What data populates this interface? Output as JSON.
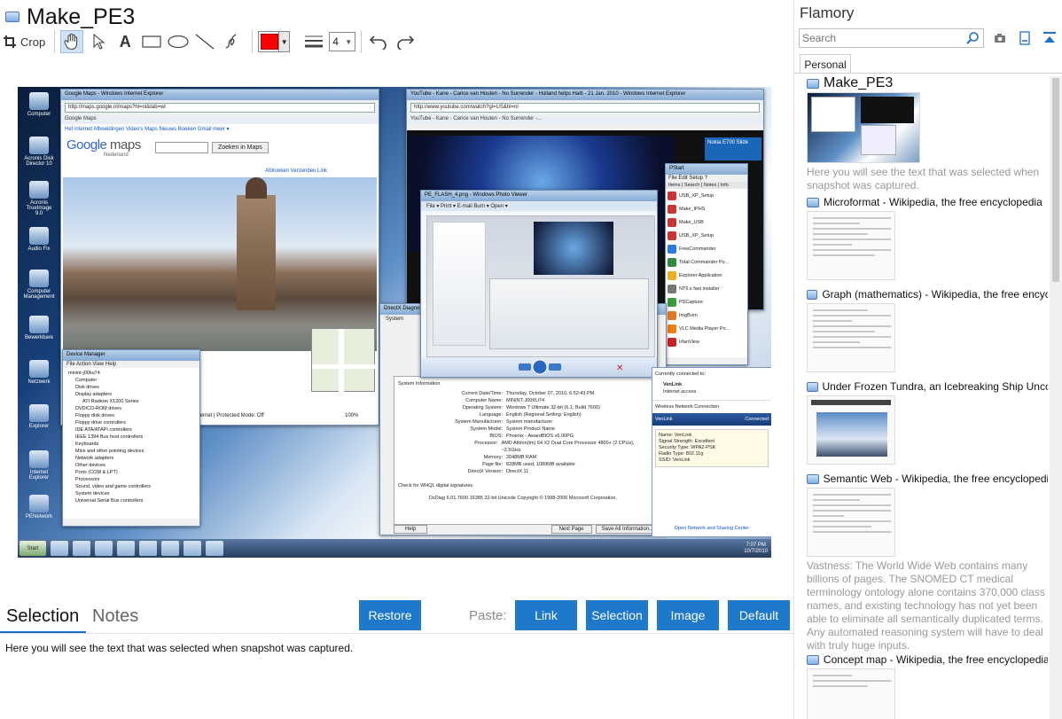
{
  "document": {
    "title": "Make_PE3"
  },
  "toolbar": {
    "crop_label": "Crop",
    "text_tool": "A",
    "line_width": "4",
    "color_hex": "#ff0000"
  },
  "preview": {
    "desktop_icons": [
      "Computer",
      "Acronis Disk Director 10",
      "Acronis TrueImage 9.0",
      "Audio Fix",
      "Computer Management",
      "Bewerkbare",
      "Netzwerk",
      "Explorer",
      "Internet Explorer",
      "PENetwork"
    ],
    "maps_window": {
      "caption": "Google Maps - Windows Internet Explorer",
      "address": "http://maps.google.nl/maps?hl=nl&tab=wl",
      "tab": "Google Maps",
      "nav": "Het internet  Afbeeldingen  Video's  Maps  Nieuws  Boeken  Gmail  meer ▾",
      "logo_word": "Google",
      "logo_maps": "maps",
      "sub": "Nederland",
      "search_btn": "Zoeken in Maps",
      "links": "Afdrukken   Verzenden   Link",
      "status": "Internet | Protected Mode: Off",
      "zoom": "100%"
    },
    "device_manager": {
      "caption": "Device Manager",
      "menu": "File   Action   View   Help",
      "items": [
        "minint-j00ku74",
        "Computer",
        "Disk drives",
        "Display adapters",
        "ATI Radeon X1200 Series",
        "DVD/CD-ROM drives",
        "Floppy disk drives",
        "Floppy drive controllers",
        "IDE ATA/ATAPI controllers",
        "IEEE 1394 Bus host controllers",
        "Keyboards",
        "Mice and other pointing devices",
        "Network adapters",
        "Other devices",
        "Ports (COM & LPT)",
        "Processors",
        "Sound, video and game controllers",
        "System devices",
        "Universal Serial Bus controllers"
      ]
    },
    "youtube_window": {
      "caption": "YouTube - Kane - Carice van Houten - No Surrender - Holland helps Haiti - 21 Jan. 2010 - Windows Internet Explorer",
      "address": "http://www.youtube.com/watch?gl=US&hl=nl",
      "tab": "YouTube - Kane - Carice van Houten - No Surrender -...",
      "ad": "Nokia E700 Slide"
    },
    "photo_viewer": {
      "caption": "PE_FLASH_4.png - Windows Photo Viewer",
      "menu": "File ▾   Print ▾   E-mail   Burn ▾   Open ▾"
    },
    "pstart": {
      "caption": "PStart",
      "menu": "File  Edit  Setup  ?",
      "tabs": "Items | Search | Notes | Info",
      "items": [
        "USB_XP_Setup",
        "Make_IPHS",
        "Make_USB",
        "USB_XP_Setup",
        "FreeCommander",
        "Total Commander Po...",
        "Explorer Application",
        "NT6.x fast installer",
        "PSCapture",
        "ImgBurn",
        "VLC Media Player Po...",
        "IrfanView"
      ]
    },
    "dxdiag": {
      "caption": "DirectX Diagnostic Tool",
      "tab": "System",
      "section": "System Information",
      "rows": [
        {
          "k": "Current Date/Time:",
          "v": "Thursday, October 07, 2010, 6:52:43 PM"
        },
        {
          "k": "Computer Name:",
          "v": "MININT-J00KU74"
        },
        {
          "k": "Operating System:",
          "v": "Windows 7 Ultimate 32-bit (6.1, Build 7600)"
        },
        {
          "k": "Language:",
          "v": "English (Regional Setting: English)"
        },
        {
          "k": "System Manufacturer:",
          "v": "System manufacturer"
        },
        {
          "k": "System Model:",
          "v": "System Product Name"
        },
        {
          "k": "BIOS:",
          "v": "Phoenix - AwardBIOS v6.00PG"
        },
        {
          "k": "Processor:",
          "v": "AMD Athlon(tm) 64 X2 Dual Core Processor 4800+ (2 CPUs), ~2.5GHz"
        },
        {
          "k": "Memory:",
          "v": "2048MB RAM"
        },
        {
          "k": "Page file:",
          "v": "828MB used, 1089MB available"
        },
        {
          "k": "DirectX Version:",
          "v": "DirectX 11"
        }
      ],
      "whql": "Check for WHQL digital signatures",
      "footer": "DxDiag 6.01.7600.16385 32-bit Unicode  Copyright © 1998-2006 Microsoft Corporation.",
      "help": "Help",
      "next": "Next Page",
      "save": "Save All Information..."
    },
    "network_popup": {
      "connected_to": "Currently connected to:",
      "network": "VenLink",
      "access": "Internet access",
      "section": "Wireless Network Connection",
      "status": "Connected",
      "details": [
        "Name: VenLink",
        "Signal Strength: Excellent",
        "Security Type: WPA2-PSK",
        "Radio Type: 802.11g",
        "SSID: VenLink"
      ],
      "footer": "Open Network and Sharing Center"
    },
    "taskbar": {
      "start": "Start",
      "time": "7:07 PM",
      "date": "10/7/2010"
    }
  },
  "tabs": {
    "selection": "Selection",
    "notes": "Notes"
  },
  "actions": {
    "restore": "Restore",
    "paste_label": "Paste:",
    "link": "Link",
    "selection": "Selection",
    "image": "Image",
    "default": "Default"
  },
  "selection_text": "Here you will see the text that was selected when snapshot was captured.",
  "sidebar": {
    "app_name": "Flamory",
    "search_placeholder": "Search",
    "tab": "Personal",
    "snapshots": [
      {
        "title": "Make_PE3",
        "desc": "Here you will see the text that was selected when snapshot was captured."
      },
      {
        "title": "Microformat - Wikipedia, the free encyclopedia",
        "desc": ""
      },
      {
        "title": "Graph (mathematics) - Wikipedia, the free encyclopedia",
        "desc": ""
      },
      {
        "title": "Under Frozen Tundra, an Icebreaking Ship Uncovers...",
        "desc": ""
      },
      {
        "title": "Semantic Web - Wikipedia, the free encyclopedia",
        "desc": "Vastness: The World Wide Web contains many billions of pages. The SNOMED CT medical terminology ontology alone contains 370,000 class names, and existing technology has not yet been able to eliminate all semantically duplicated terms. Any automated reasoning system will have to deal with truly huge inputs."
      },
      {
        "title": "Concept map - Wikipedia, the free encyclopedia",
        "desc": ""
      }
    ]
  }
}
